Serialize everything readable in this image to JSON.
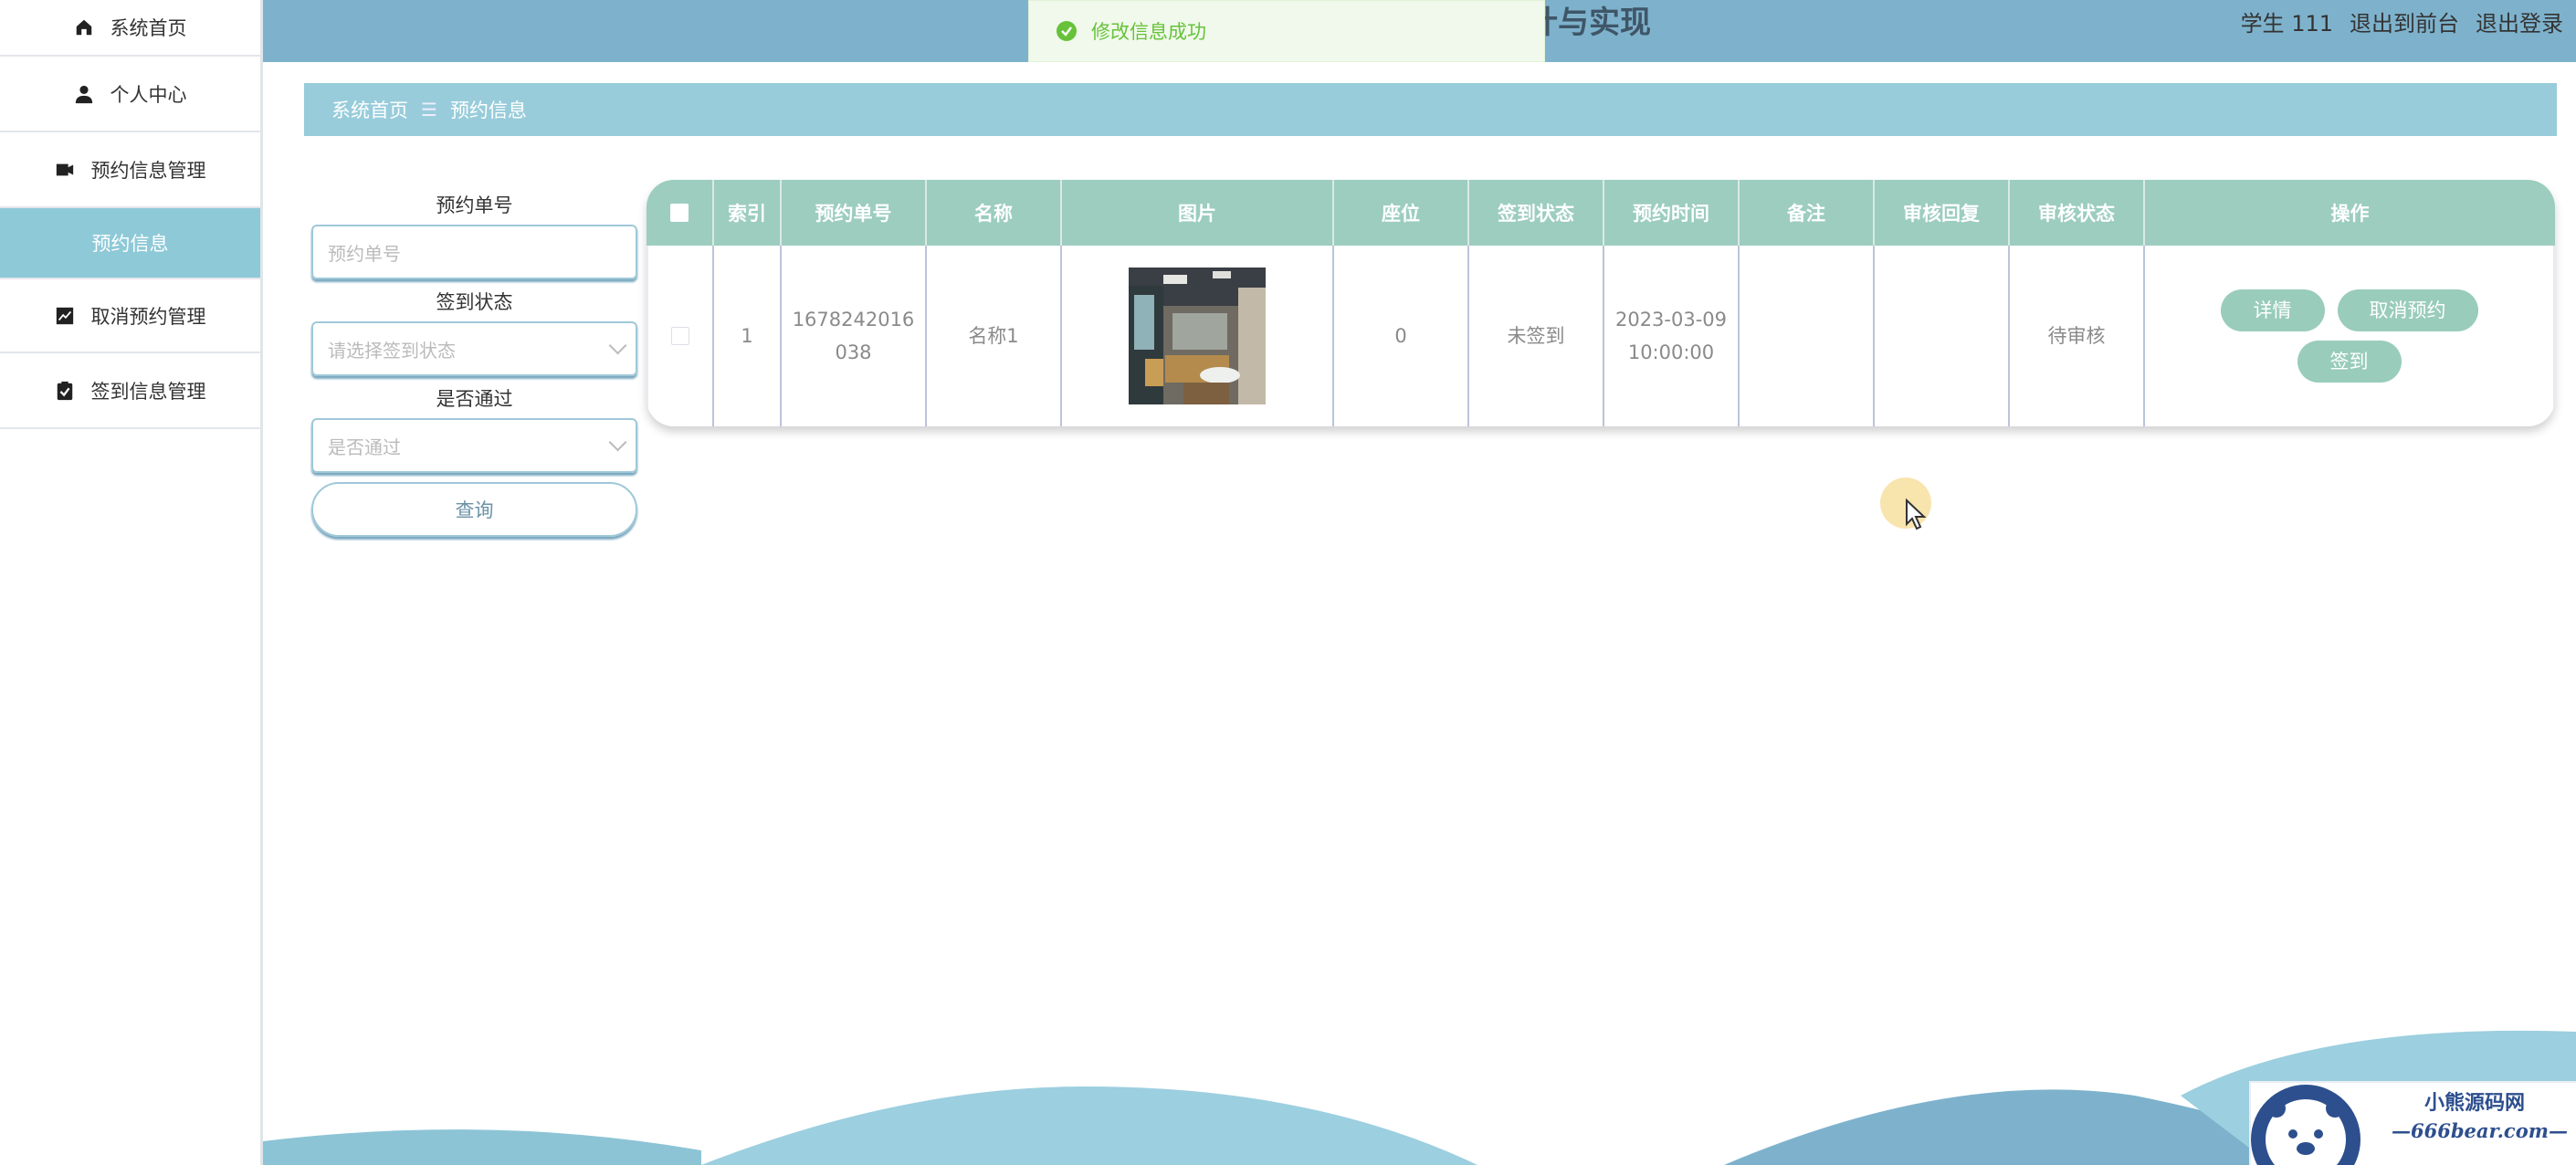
{
  "sidebar": {
    "items": [
      {
        "label": "系统首页",
        "icon": "home-icon"
      },
      {
        "label": "个人中心",
        "icon": "user-icon"
      },
      {
        "label": "预约信息管理",
        "icon": "ticket-icon"
      },
      {
        "label": "预约信息",
        "icon": ""
      },
      {
        "label": "取消预约管理",
        "icon": "chart-icon"
      },
      {
        "label": "签到信息管理",
        "icon": "clipboard-check-icon"
      }
    ],
    "active_item": "预约信息"
  },
  "header": {
    "title": "高校自习室预约系统的设计与实现",
    "user": "学生 111",
    "exit_front": "退出到前台",
    "logout": "退出登录"
  },
  "toast": {
    "message": "修改信息成功",
    "icon": "check-circle-icon"
  },
  "breadcrumb": {
    "home": "系统首页",
    "separator": "☰",
    "current": "预约信息"
  },
  "search": {
    "order_label": "预约单号",
    "order_placeholder": "预约单号",
    "signin_label": "签到状态",
    "signin_placeholder": "请选择签到状态",
    "pass_label": "是否通过",
    "pass_placeholder": "是否通过",
    "query_button": "查询"
  },
  "table": {
    "headers": {
      "index": "索引",
      "order_no": "预约单号",
      "name": "名称",
      "image": "图片",
      "seat": "座位",
      "signin_status": "签到状态",
      "time": "预约时间",
      "remark": "备注",
      "review_reply": "审核回复",
      "review_status": "审核状态",
      "actions": "操作"
    },
    "rows": [
      {
        "index": "1",
        "order_no_1": "1678242016",
        "order_no_2": "038",
        "name": "名称1",
        "seat": "0",
        "signin_status": "未签到",
        "time_1": "2023-03-09",
        "time_2": "10:00:00",
        "remark": "",
        "review_reply": "",
        "review_status": "待审核",
        "btn_detail": "详情",
        "btn_cancel": "取消预约",
        "btn_signin": "签到"
      }
    ]
  },
  "watermark": {
    "line1": "小熊源码网",
    "line2": "—666bear.com—"
  },
  "colors": {
    "header": "#7eb2cc",
    "breadcrumb": "#98ccdb",
    "table_head": "#9ccdbf",
    "action_button": "#99ccbb",
    "sidebar_active": "#8ec9d7",
    "toast_bg": "#f0f9eb",
    "toast_text": "#67c23a"
  }
}
